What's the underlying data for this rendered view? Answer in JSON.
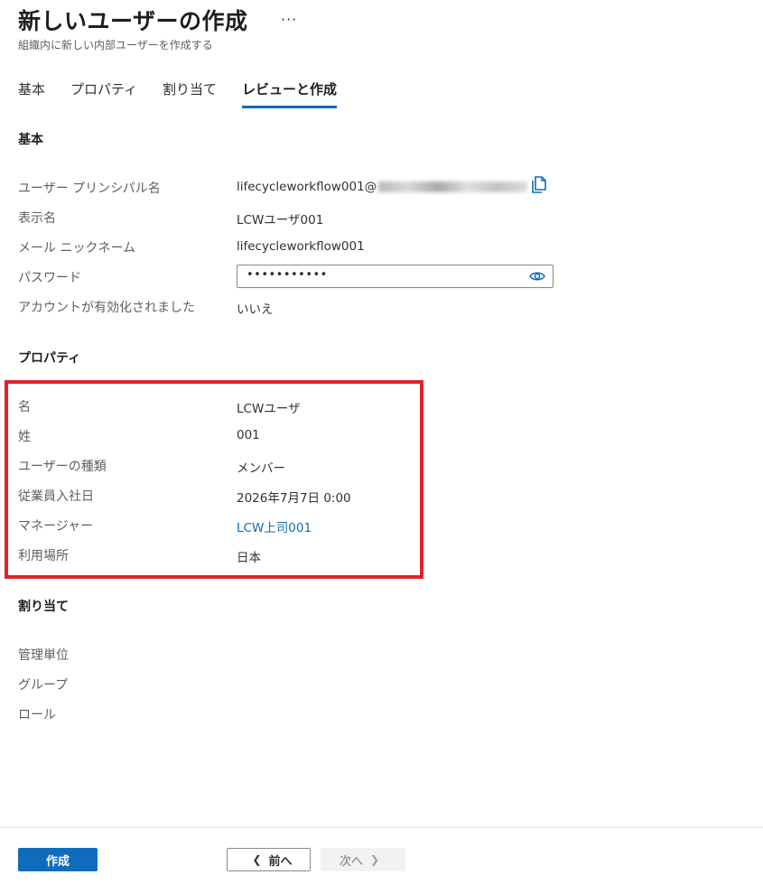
{
  "header": {
    "title": "新しいユーザーの作成",
    "more": "···",
    "subtitle": "組織内に新しい内部ユーザーを作成する"
  },
  "tabs": [
    {
      "label": "基本",
      "active": false
    },
    {
      "label": "プロパティ",
      "active": false
    },
    {
      "label": "割り当て",
      "active": false
    },
    {
      "label": "レビューと作成",
      "active": true
    }
  ],
  "basic": {
    "section_title": "基本",
    "upn_label": "ユーザー プリンシパル名",
    "upn_value": "lifecycleworkflow001@",
    "display_name_label": "表示名",
    "display_name_value": "LCWユーザ001",
    "mail_nickname_label": "メール ニックネーム",
    "mail_nickname_value": "lifecycleworkflow001",
    "password_label": "パスワード",
    "password_value": "•••••••••••",
    "account_enabled_label": "アカウントが有効化されました",
    "account_enabled_value": "いいえ"
  },
  "properties": {
    "section_title": "プロパティ",
    "first_name_label": "名",
    "first_name_value": "LCWユーザ",
    "last_name_label": "姓",
    "last_name_value": "001",
    "user_type_label": "ユーザーの種類",
    "user_type_value": "メンバー",
    "hire_date_label": "従業員入社日",
    "hire_date_value": "2026年7月7日 0:00",
    "manager_label": "マネージャー",
    "manager_value": "LCW上司001",
    "usage_location_label": "利用場所",
    "usage_location_value": "日本"
  },
  "assignments": {
    "section_title": "割り当て",
    "admin_units_label": "管理単位",
    "groups_label": "グループ",
    "roles_label": "ロール"
  },
  "footer": {
    "create_label": "作成",
    "prev_label": "前へ",
    "next_label": "次へ"
  },
  "colors": {
    "accent": "#0f6cbd",
    "highlight_border": "#e32228"
  },
  "icons": {
    "copy": "copy-icon",
    "reveal_password": "eye-icon",
    "prev": "chevron-left-icon",
    "next": "chevron-right-icon"
  }
}
